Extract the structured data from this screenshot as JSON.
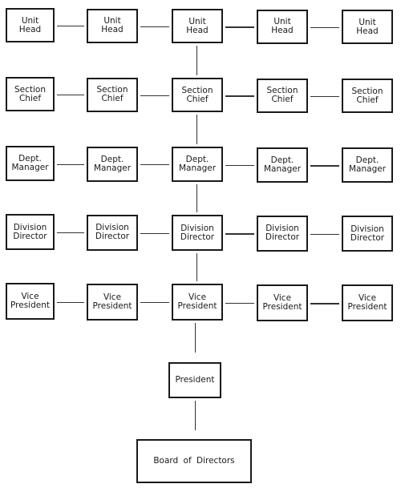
{
  "rows": [
    {
      "label": "Unit\nHead",
      "count": 5
    },
    {
      "label": "Section\nChief",
      "count": 5
    },
    {
      "label": "Dept.\nManager",
      "count": 5
    },
    {
      "label": "Division\nDirector",
      "count": 5
    },
    {
      "label": "Vice\nPresident",
      "count": 5
    }
  ],
  "president": "President",
  "board": "Board of Directors"
}
